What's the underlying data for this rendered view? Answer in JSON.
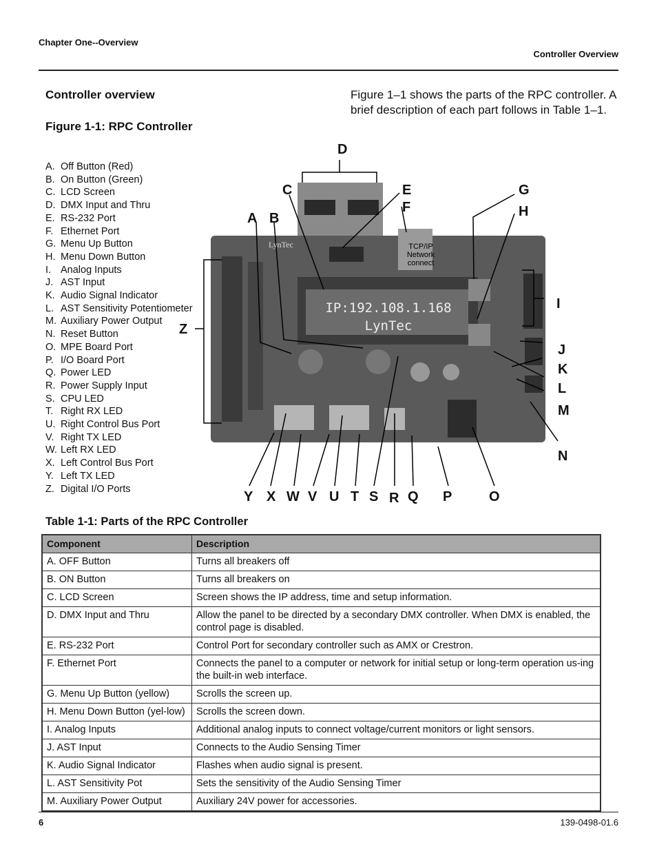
{
  "header": {
    "chapter": "Chapter One--Overview",
    "section": "Controller Overview"
  },
  "section_title": "Controller overview",
  "figure_caption": "Figure 1-1:  RPC Controller",
  "intro": "Figure 1–1 shows the parts of the RPC controller. A brief description of each part follows in Table 1–1.",
  "parts_list": [
    {
      "key": "A.",
      "label": "Off Button (Red)"
    },
    {
      "key": "B.",
      "label": "On Button (Green)"
    },
    {
      "key": "C.",
      "label": "LCD Screen"
    },
    {
      "key": "D.",
      "label": "DMX Input and Thru"
    },
    {
      "key": "E.",
      "label": "RS-232 Port"
    },
    {
      "key": "F.",
      "label": "Ethernet Port"
    },
    {
      "key": "G.",
      "label": "Menu Up Button"
    },
    {
      "key": "H.",
      "label": "Menu Down Button"
    },
    {
      "key": "I.",
      "label": "Analog Inputs"
    },
    {
      "key": "J.",
      "label": "AST Input"
    },
    {
      "key": "K.",
      "label": "Audio Signal Indicator"
    },
    {
      "key": "L.",
      "label": "AST Sensitivity Potentiometer"
    },
    {
      "key": "M.",
      "label": "Auxiliary Power Output"
    },
    {
      "key": "N.",
      "label": "Reset Button"
    },
    {
      "key": "O.",
      "label": "MPE Board Port"
    },
    {
      "key": "P.",
      "label": "I/O Board Port"
    },
    {
      "key": "Q.",
      "label": "Power LED"
    },
    {
      "key": "R.",
      "label": "Power Supply Input"
    },
    {
      "key": "S.",
      "label": "CPU LED"
    },
    {
      "key": "T.",
      "label": "Right RX LED"
    },
    {
      "key": "U.",
      "label": "Right Control Bus Port"
    },
    {
      "key": "V.",
      "label": "Right TX LED"
    },
    {
      "key": "W.",
      "label": "Left RX LED"
    },
    {
      "key": "X.",
      "label": "Left Control Bus Port"
    },
    {
      "key": "Y.",
      "label": "Left TX LED"
    },
    {
      "key": "Z.",
      "label": "Digital I/O Ports"
    }
  ],
  "figure": {
    "lcd_line1": "IP:192.108.1.168",
    "lcd_line2": "LynTec",
    "network_label": "TCP/IP Network connect",
    "brand": "LynTec",
    "callouts": {
      "A": "A",
      "B": "B",
      "C": "C",
      "D": "D",
      "E": "E",
      "F": "F",
      "G": "G",
      "H": "H",
      "I": "I",
      "J": "J",
      "K": "K",
      "L": "L",
      "M": "M",
      "N": "N",
      "O": "O",
      "P": "P",
      "Q": "Q",
      "R": "R",
      "S": "S",
      "T": "T",
      "U": "U",
      "V": "V",
      "W": "W",
      "X": "X",
      "Y": "Y",
      "Z": "Z"
    }
  },
  "table": {
    "title": "Table 1-1: Parts of the RPC Controller",
    "headers": [
      "Component",
      "Description"
    ],
    "rows": [
      [
        "A.  OFF Button",
        "Turns all breakers off"
      ],
      [
        "B.  ON Button",
        "Turns all breakers on"
      ],
      [
        "C.  LCD Screen",
        "Screen shows the IP address, time and setup information."
      ],
      [
        "D.  DMX Input and Thru",
        "Allow the panel to be directed by a secondary DMX controller.  When DMX is enabled, the control page is disabled."
      ],
      [
        "E.  RS-232 Port",
        "Control Port for secondary controller such as AMX or Crestron."
      ],
      [
        "F.  Ethernet Port",
        "Connects the panel to a computer or network for initial setup or long-term operation us-ing the built-in web interface."
      ],
      [
        "G. Menu Up Button (yellow)",
        "Scrolls the screen up."
      ],
      [
        "H. Menu Down Button (yel-low)",
        "Scrolls the screen down."
      ],
      [
        "I.  Analog Inputs",
        "Additional analog inputs to connect voltage/current monitors or light sensors."
      ],
      [
        "J.  AST Input",
        "Connects to the Audio Sensing Timer"
      ],
      [
        "K.  Audio Signal Indicator",
        "Flashes when audio signal is present."
      ],
      [
        "L.  AST Sensitivity Pot",
        "Sets the sensitivity of the Audio Sensing Timer"
      ],
      [
        "M. Auxiliary Power Output",
        "Auxiliary 24V power for accessories."
      ]
    ]
  },
  "footer": {
    "page": "6",
    "doc_number": "139-0498-01.6"
  }
}
